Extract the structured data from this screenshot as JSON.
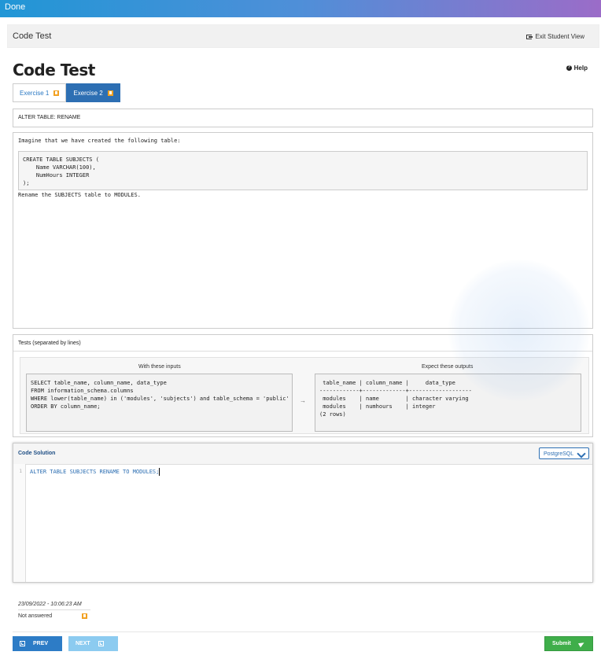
{
  "topbar": {
    "done_label": "Done"
  },
  "header": {
    "title": "Code Test",
    "exit_label": "Exit Student View"
  },
  "page": {
    "title": "Code Test",
    "help_label": "Help"
  },
  "tabs": [
    {
      "label": "Exercise 1",
      "active": false
    },
    {
      "label": "Exercise 2",
      "active": true
    }
  ],
  "exercise": {
    "subtitle": "ALTER TABLE: RENAME",
    "intro": "Imagine that we have created the following table:",
    "code": "CREATE TABLE SUBJECTS (\n    Name VARCHAR(100),\n    NumHours INTEGER\n);",
    "instruction": "Rename the SUBJECTS table to MODULES."
  },
  "tests": {
    "header": "Tests (separated by lines)",
    "inputs_label": "With these inputs",
    "outputs_label": "Expect these outputs",
    "input": "SELECT table_name, column_name, data_type\nFROM information_schema.columns\nWHERE lower(table_name) in ('modules', 'subjects') and table_schema = 'public'\nORDER BY column_name;",
    "output": " table_name | column_name |     data_type\n------------+-------------+-------------------\n modules    | name        | character varying\n modules    | numhours    | integer\n(2 rows)",
    "arrow": "→"
  },
  "solution": {
    "header": "Code Solution",
    "language": "PostgreSQL",
    "line_number": "1",
    "code": "ALTER TABLE SUBJECTS RENAME TO MODULES;"
  },
  "status": {
    "timestamp": "23/09/2022 - 10:06:23 AM",
    "answer_state": "Not answered"
  },
  "footer": {
    "prev_label": "PREV",
    "next_label": "NEXT",
    "submit_label": "Submit"
  },
  "colors": {
    "primary": "#2d6fb3",
    "submit": "#3fae4a",
    "bookmark": "#f2a122",
    "next_disabled": "#8ccbf0"
  }
}
